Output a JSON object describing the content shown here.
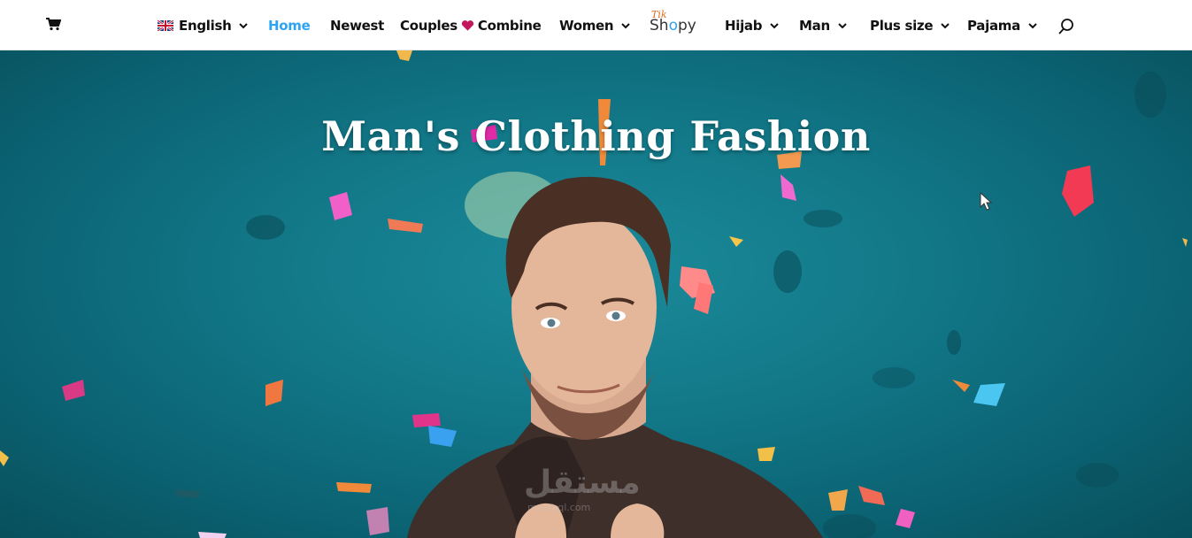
{
  "nav": {
    "cart_icon": "shopping-cart-icon",
    "language": "English",
    "items": [
      {
        "label": "Home"
      },
      {
        "label": "Newest"
      },
      {
        "label": "Couples"
      },
      {
        "label": "Combine"
      },
      {
        "label": "Women"
      },
      {
        "label": "Hijab"
      },
      {
        "label": "Man"
      },
      {
        "label": "Plus size"
      },
      {
        "label": "Pajama"
      }
    ],
    "logo": {
      "top": "Tik",
      "main_s": "Sh",
      "main_o": "o",
      "main_end": "py"
    },
    "search_icon": "search-icon"
  },
  "hero": {
    "title": "Man's Clothing Fashion",
    "watermark": "مستقل",
    "watermark_sub": "mostaql.com"
  },
  "colors": {
    "active": "#2ea3f2",
    "heart": "#c2185b",
    "hero_bg": "#137a8a"
  }
}
